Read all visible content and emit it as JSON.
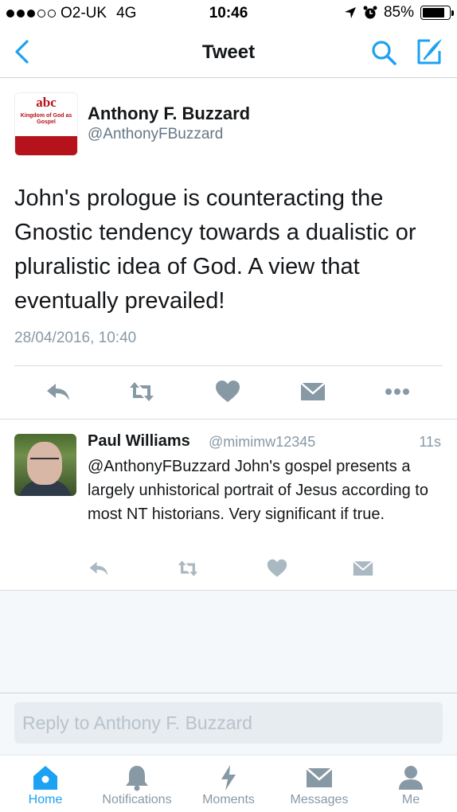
{
  "status_bar": {
    "carrier": "O2-UK",
    "network": "4G",
    "time": "10:46",
    "battery": "85%",
    "battery_level": 0.85,
    "signal_bars": 3,
    "signal_total": 5
  },
  "nav": {
    "title": "Tweet",
    "back_icon": "chevron-left-icon",
    "search_icon": "search-icon",
    "compose_icon": "compose-icon"
  },
  "tweet": {
    "author_name": "Anthony F. Buzzard",
    "author_handle": "@AnthonyFBuzzard",
    "avatar_logo": "abc",
    "avatar_banner": "Kingdom of God as Gospel",
    "text": "John's prologue is counteracting the Gnostic tendency towards a dualistic or pluralistic idea of God. A view that eventually prevailed!",
    "timestamp": "28/04/2016, 10:40"
  },
  "reply": {
    "author_name": "Paul Williams",
    "author_handle": "@mimimw12345",
    "time": "11s",
    "text": "@AnthonyFBuzzard John's gospel presents a largely unhistorical portrait of Jesus according to most NT historians. Very significant if true."
  },
  "reply_bar": {
    "placeholder": "Reply to Anthony F. Buzzard"
  },
  "tabs": [
    {
      "label": "Home",
      "icon": "home-icon",
      "active": true
    },
    {
      "label": "Notifications",
      "icon": "bell-icon",
      "active": false
    },
    {
      "label": "Moments",
      "icon": "lightning-icon",
      "active": false
    },
    {
      "label": "Messages",
      "icon": "envelope-icon",
      "active": false
    },
    {
      "label": "Me",
      "icon": "person-icon",
      "active": false
    }
  ],
  "colors": {
    "accent": "#1da1f2",
    "icon_gray": "#8899a6",
    "text": "#14171a",
    "secondary_text": "#657786"
  }
}
